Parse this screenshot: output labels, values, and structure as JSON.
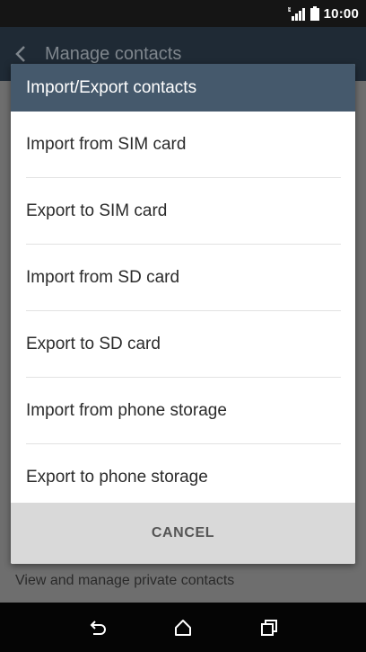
{
  "status_bar": {
    "time": "10:00",
    "signal_icon": "signal-icon",
    "battery_icon": "battery-icon"
  },
  "app_bar": {
    "title": "Manage contacts",
    "back_icon": "back-arrow-icon"
  },
  "background": {
    "private_text": "View and manage private contacts"
  },
  "dialog": {
    "title": "Import/Export contacts",
    "options": [
      {
        "label": "Import from SIM card"
      },
      {
        "label": "Export to SIM card"
      },
      {
        "label": "Import from SD card"
      },
      {
        "label": "Export to SD card"
      },
      {
        "label": "Import from phone storage"
      },
      {
        "label": "Export to phone storage"
      }
    ],
    "cancel_label": "CANCEL"
  },
  "nav_bar": {
    "back_icon": "nav-back-icon",
    "home_icon": "home-icon",
    "recents_icon": "recents-icon"
  },
  "colors": {
    "header": "#45596c",
    "app_bar": "#1f2a35",
    "dim_background": "#6e6e6e",
    "footer": "#d9d9d9"
  }
}
